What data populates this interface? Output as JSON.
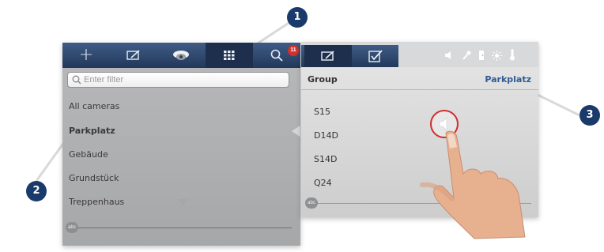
{
  "toolbar": {
    "buttons": [
      {
        "name": "add",
        "icon": "plus-icon"
      },
      {
        "name": "edit",
        "icon": "edit-icon"
      },
      {
        "name": "camera",
        "icon": "camera-dome-icon"
      },
      {
        "name": "grid",
        "icon": "grid-icon",
        "active": true
      },
      {
        "name": "search",
        "icon": "search-icon"
      }
    ],
    "badge_count": "11"
  },
  "filter": {
    "placeholder": "Enter filter"
  },
  "camera_list": [
    {
      "label": "All cameras",
      "bold": false
    },
    {
      "label": "Parkplatz",
      "bold": true
    },
    {
      "label": "Gebäude",
      "bold": false
    },
    {
      "label": "Grundstück",
      "bold": false
    },
    {
      "label": "Treppenhaus",
      "bold": false
    }
  ],
  "abc_label": "abc",
  "right_panel": {
    "toolbar_icons": [
      "edit-icon",
      "checklist-icon",
      "speaker-icon",
      "key-icon",
      "door-icon",
      "light-icon",
      "thermometer-icon"
    ],
    "group_label": "Group",
    "group_value": "Parkplatz",
    "cameras": [
      "S15",
      "D14D",
      "S14D",
      "Q24"
    ],
    "abc_label": "abc",
    "highlight_icon": "speaker-icon"
  },
  "callouts": [
    "1",
    "2",
    "3"
  ],
  "colors": {
    "toolbar": "#22385a",
    "active": "#1d2f4d",
    "link": "#2e5b93",
    "highlight": "#d32c2c",
    "callout": "#1a3a6b",
    "badge": "#d2302c"
  }
}
